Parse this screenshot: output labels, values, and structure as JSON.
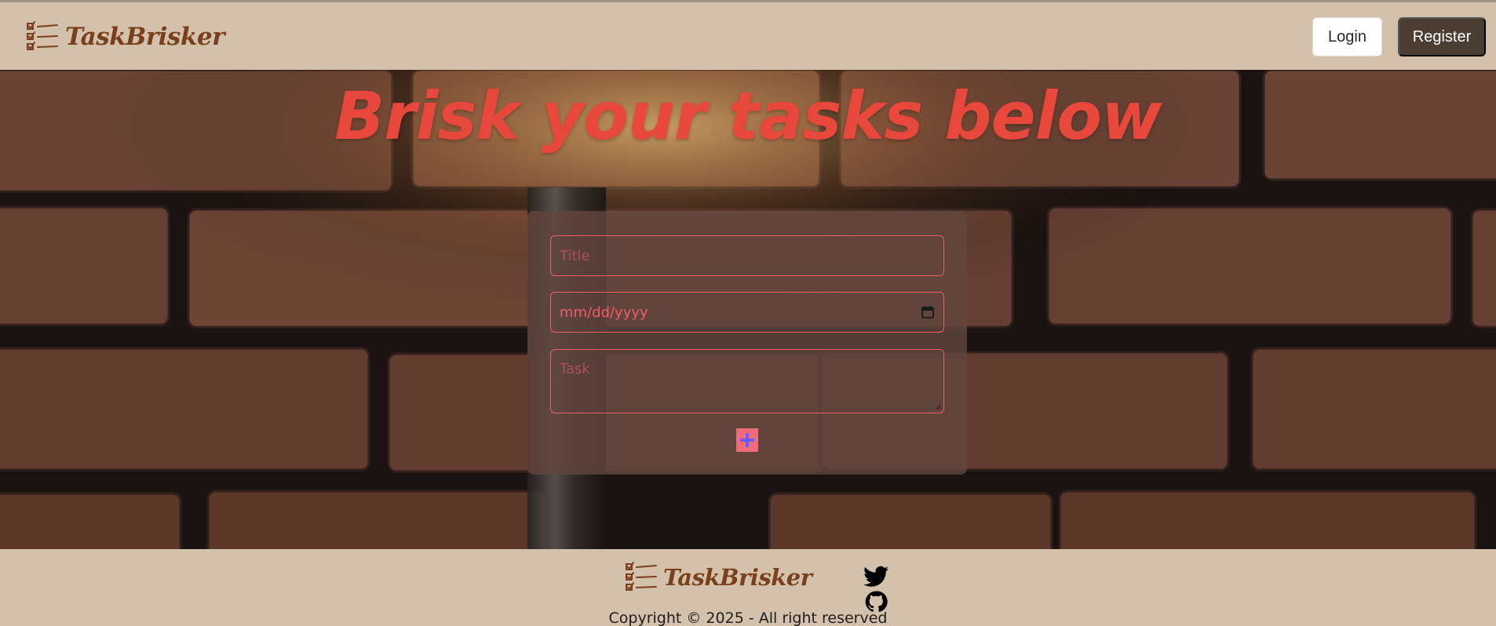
{
  "navbar": {
    "brand": "TaskBrisker",
    "brand_icon": "checklist-icon",
    "login_label": "Login",
    "register_label": "Register"
  },
  "hero": {
    "headline": "Brisk your tasks below",
    "form": {
      "title_placeholder": "Title",
      "date_placeholder": "mm/dd/yyyy",
      "date_icon": "calendar-icon",
      "task_placeholder": "Task",
      "add_icon": "plus-icon"
    }
  },
  "footer": {
    "brand": "TaskBrisker",
    "social_icons": [
      "twitter-icon",
      "github-icon"
    ],
    "copyright": "Copyright © 2025 - All right reserved"
  },
  "colors": {
    "nav_bg": "#d4c1ac",
    "brand_text": "#7a3f1c",
    "headline": "#e8473b",
    "field_accent": "#f05d6a",
    "register_bg": "#4c3e32"
  }
}
